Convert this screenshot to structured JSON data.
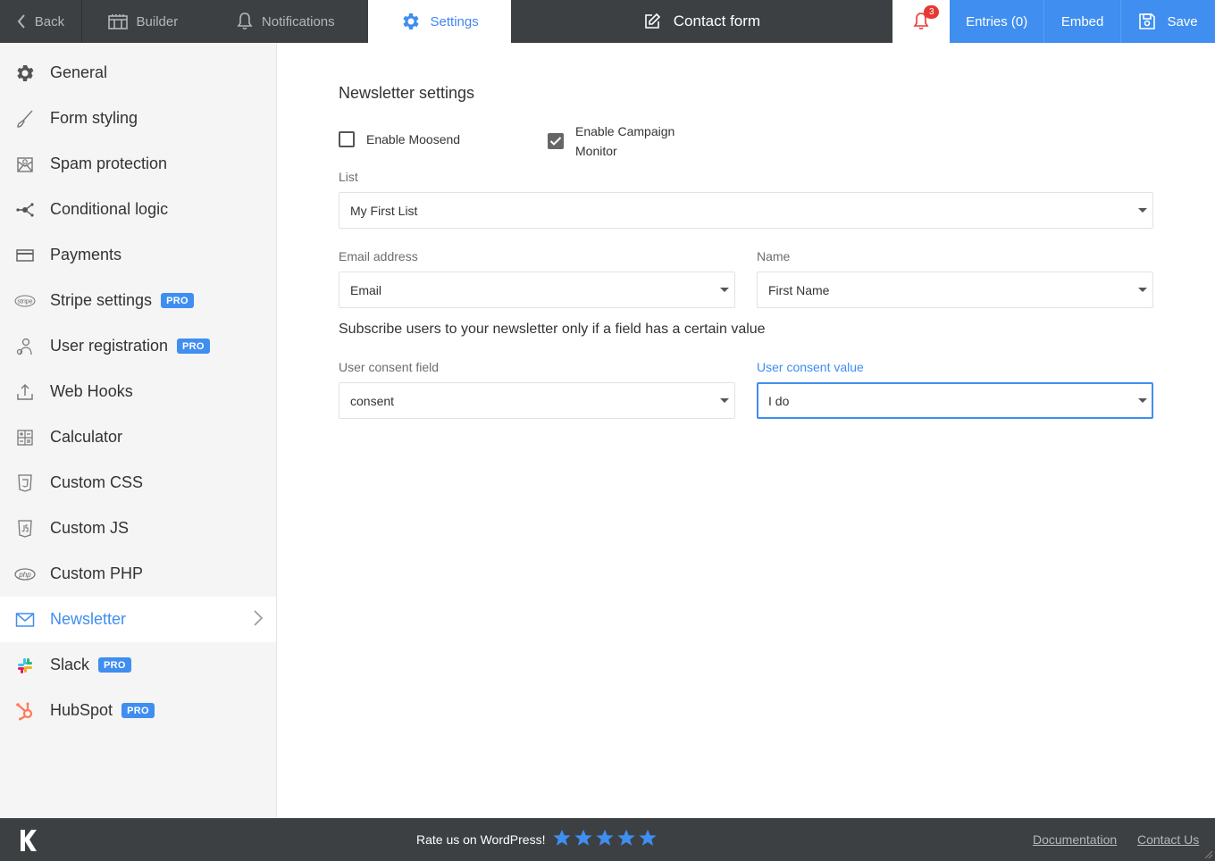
{
  "topbar": {
    "back": "Back",
    "builder": "Builder",
    "notifications": "Notifications",
    "settings": "Settings",
    "form_title": "Contact form",
    "bell_count": "3",
    "entries": "Entries (0)",
    "embed": "Embed",
    "save": "Save"
  },
  "sidebar": {
    "items": [
      {
        "label": "General",
        "icon": "gear-icon"
      },
      {
        "label": "Form styling",
        "icon": "brush-icon"
      },
      {
        "label": "Spam protection",
        "icon": "mail-shield-icon"
      },
      {
        "label": "Conditional logic",
        "icon": "branch-icon"
      },
      {
        "label": "Payments",
        "icon": "credit-card-icon"
      },
      {
        "label": "Stripe settings",
        "icon": "stripe-icon",
        "badge": "PRO"
      },
      {
        "label": "User registration",
        "icon": "user-icon",
        "badge": "PRO"
      },
      {
        "label": "Web Hooks",
        "icon": "upload-icon"
      },
      {
        "label": "Calculator",
        "icon": "calculator-icon"
      },
      {
        "label": "Custom CSS",
        "icon": "css-icon"
      },
      {
        "label": "Custom JS",
        "icon": "js-icon"
      },
      {
        "label": "Custom PHP",
        "icon": "php-icon"
      },
      {
        "label": "Newsletter",
        "icon": "envelope-icon",
        "active": true
      },
      {
        "label": "Slack",
        "icon": "slack-icon",
        "badge": "PRO"
      },
      {
        "label": "HubSpot",
        "icon": "hubspot-icon",
        "badge": "PRO"
      }
    ]
  },
  "main": {
    "heading": "Newsletter settings",
    "enable_moosend": {
      "label": "Enable Moosend",
      "checked": false
    },
    "enable_campaign_monitor": {
      "label_line1": "Enable Campaign",
      "label_line2": "Monitor",
      "checked": true
    },
    "list": {
      "label": "List",
      "value": "My First List"
    },
    "email": {
      "label": "Email address",
      "value": "Email"
    },
    "name": {
      "label": "Name",
      "value": "First Name"
    },
    "subscribe_text": "Subscribe users to your newsletter only if a field has a certain value",
    "consent_field": {
      "label": "User consent field",
      "value": "consent"
    },
    "consent_value": {
      "label": "User consent value",
      "value": "I do"
    }
  },
  "footer": {
    "rate_text": "Rate us on WordPress!",
    "stars": 5,
    "documentation": "Documentation",
    "contact_us": "Contact Us"
  },
  "colors": {
    "accent": "#3f8ef0",
    "dark_bar": "#3c4043",
    "badge_red": "#e53935"
  }
}
